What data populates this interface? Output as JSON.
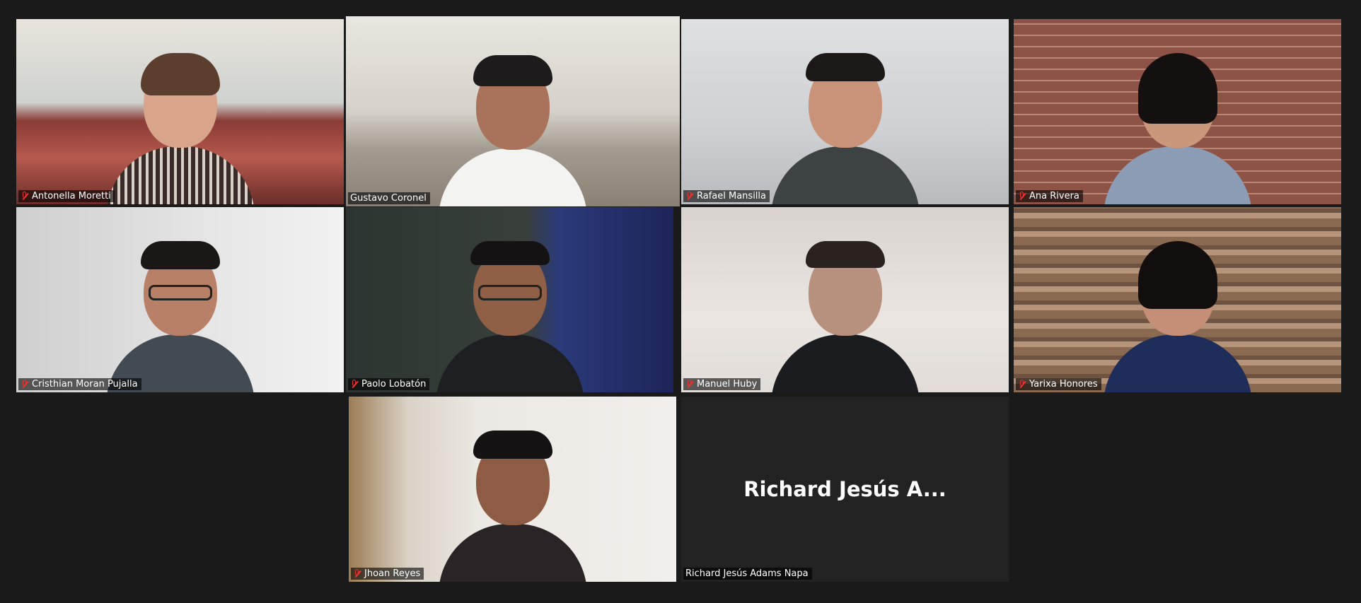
{
  "participants": [
    {
      "name": "Antonella Moretti",
      "muted": true
    },
    {
      "name": "Gustavo Coronel",
      "muted": false,
      "active_speaker": true
    },
    {
      "name": "Rafael Mansilla",
      "muted": true
    },
    {
      "name": "Ana Rivera",
      "muted": true
    },
    {
      "name": "Cristhian Moran Pujalla",
      "muted": true
    },
    {
      "name": "Paolo Lobatón",
      "muted": true
    },
    {
      "name": "Manuel Huby",
      "muted": true
    },
    {
      "name": "Yarixa Honores",
      "muted": true
    },
    {
      "name": "Jhoan Reyes",
      "muted": true
    },
    {
      "name": "Richard Jesús Adams Napa",
      "muted": false,
      "video_off": true,
      "display_label": "Richard Jesús A..."
    }
  ],
  "colors": {
    "background": "#1a1a1a",
    "active_speaker_border": "#d9ee5a",
    "muted_icon": "#e33333"
  }
}
